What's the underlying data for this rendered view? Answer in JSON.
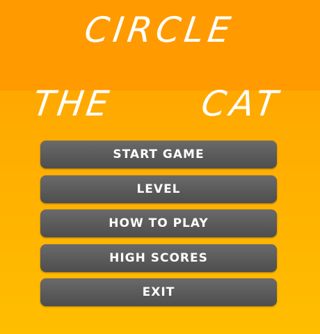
{
  "title": {
    "line1": "CIRCLE",
    "word_the": "THE",
    "word_cat": "CAT"
  },
  "menu": {
    "items": [
      {
        "label": "START GAME"
      },
      {
        "label": "LEVEL"
      },
      {
        "label": "HOW TO PLAY"
      },
      {
        "label": "HIGH SCORES"
      },
      {
        "label": "EXIT"
      }
    ]
  },
  "colors": {
    "header_orange": "#ff9a00",
    "body_orange_top": "#ffa800",
    "body_orange_bottom": "#ffbe00",
    "button_gray": "#595959",
    "text_white": "#ffffff"
  }
}
